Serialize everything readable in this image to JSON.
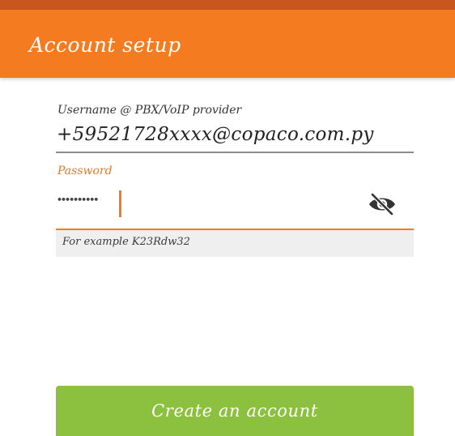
{
  "app_bar": {
    "title": "Account setup"
  },
  "form": {
    "username": {
      "label": "Username @ PBX/VoIP provider",
      "value": "+59521728xxxx@copaco.com.py"
    },
    "password": {
      "label": "Password",
      "masked_value": "••••••••••",
      "visibility_toggle_icon": "eye-off-icon"
    },
    "hint": "For example K23Rdw32"
  },
  "actions": {
    "create_account_label": "Create an account"
  },
  "colors": {
    "accent": "#f47b20",
    "status_strip": "#c8561f",
    "button": "#8cc13f",
    "hint_background": "#efefef"
  }
}
